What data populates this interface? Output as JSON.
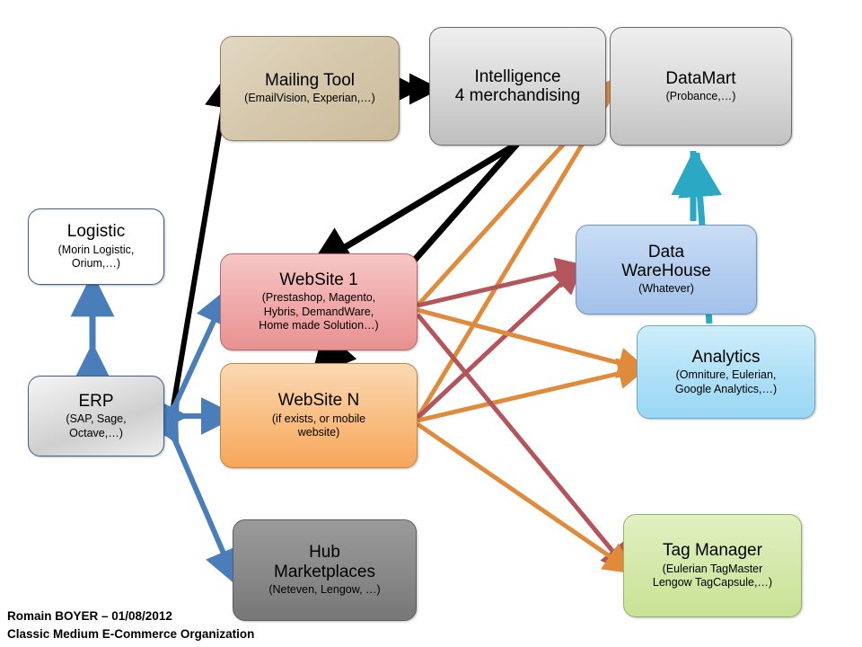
{
  "diagram": {
    "title": "Classic Medium E-Commerce Organization",
    "author_line": "Romain BOYER – 01/08/2012",
    "nodes": [
      {
        "id": "mailing",
        "title": "Mailing Tool",
        "sub": "(EmailVision, Experian,…)"
      },
      {
        "id": "intel",
        "title": "Intelligence\n4 merchandising",
        "title_l1": "Intelligence",
        "title_l2": "4 merchandising",
        "sub": ""
      },
      {
        "id": "datamart",
        "title": "DataMart",
        "sub": "(Probance,…)"
      },
      {
        "id": "logistic",
        "title": "Logistic",
        "sub": "(Morin Logistic,\nOrium,…)",
        "sub_l1": "(Morin Logistic,",
        "sub_l2": "Orium,…)"
      },
      {
        "id": "erp",
        "title": "ERP",
        "sub_l1": "(SAP, Sage,",
        "sub_l2": "Octave,…)"
      },
      {
        "id": "website1",
        "title": "WebSite 1",
        "sub_l1": "(Prestashop, Magento,",
        "sub_l2": "Hybris, DemandWare,",
        "sub_l3": "Home made Solution…)"
      },
      {
        "id": "websiten",
        "title": "WebSite N",
        "sub_l1": "(if exists, or mobile",
        "sub_l2": "website)"
      },
      {
        "id": "hub",
        "title_l1": "Hub",
        "title_l2": "Marketplaces",
        "sub": "(Neteven, Lengow, …)"
      },
      {
        "id": "datawarehouse",
        "title_l1": "Data",
        "title_l2": "WareHouse",
        "sub": "(Whatever)"
      },
      {
        "id": "analytics",
        "title": "Analytics",
        "sub_l1": "(Omniture, Eulerian,",
        "sub_l2": "Google Analytics,…)"
      },
      {
        "id": "tagmanager",
        "title": "Tag Manager",
        "sub_l1": "(Eulerian TagMaster",
        "sub_l2": "Lengow TagCapsule,…)"
      }
    ],
    "colors": {
      "arrow_black": "#000000",
      "arrow_blue": "#4a7ebb",
      "arrow_red": "#b4555c",
      "arrow_orange": "#e08a3c",
      "arrow_teal": "#2aa8c4",
      "mailing_fill": "#d6c8ac",
      "intelligence_fill": "#d9d9d9",
      "datamart_fill": "#dcdcdc",
      "website1_fill": "#f0a8a8",
      "websiten_fill": "#f9bd80",
      "hub_fill": "#8a8a8a",
      "datawarehouse_fill": "#b3cdef",
      "analytics_fill": "#aee0f7",
      "tagmanager_fill": "#d3e8a8",
      "logistic_fill": "#ffffff",
      "erp_fill": "#e3e3e3"
    }
  }
}
